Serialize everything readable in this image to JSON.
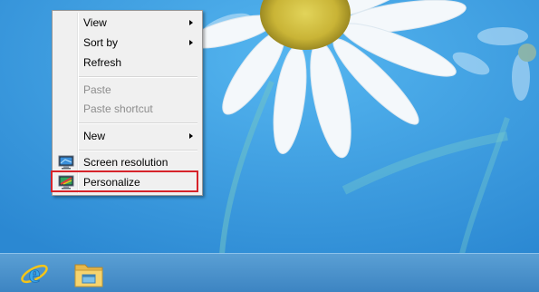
{
  "desktop": {
    "wallpaper": "daisy-flower-on-blue",
    "background_color": "#2c8fd8"
  },
  "context_menu": {
    "items": [
      {
        "label": "View",
        "enabled": true,
        "submenu": true
      },
      {
        "label": "Sort by",
        "enabled": true,
        "submenu": true
      },
      {
        "label": "Refresh",
        "enabled": true,
        "submenu": false
      },
      {
        "label": "Paste",
        "enabled": false,
        "submenu": false
      },
      {
        "label": "Paste shortcut",
        "enabled": false,
        "submenu": false
      },
      {
        "label": "New",
        "enabled": true,
        "submenu": true
      },
      {
        "label": "Screen resolution",
        "enabled": true,
        "submenu": false,
        "icon": "screen-resolution-icon"
      },
      {
        "label": "Personalize",
        "enabled": true,
        "submenu": false,
        "icon": "personalize-icon",
        "highlighted": true
      }
    ],
    "highlight_color": "#d6232a"
  },
  "taskbar": {
    "pinned": [
      {
        "name": "Internet Explorer",
        "icon": "internet-explorer-icon"
      },
      {
        "name": "File Explorer",
        "icon": "file-explorer-icon"
      }
    ]
  }
}
